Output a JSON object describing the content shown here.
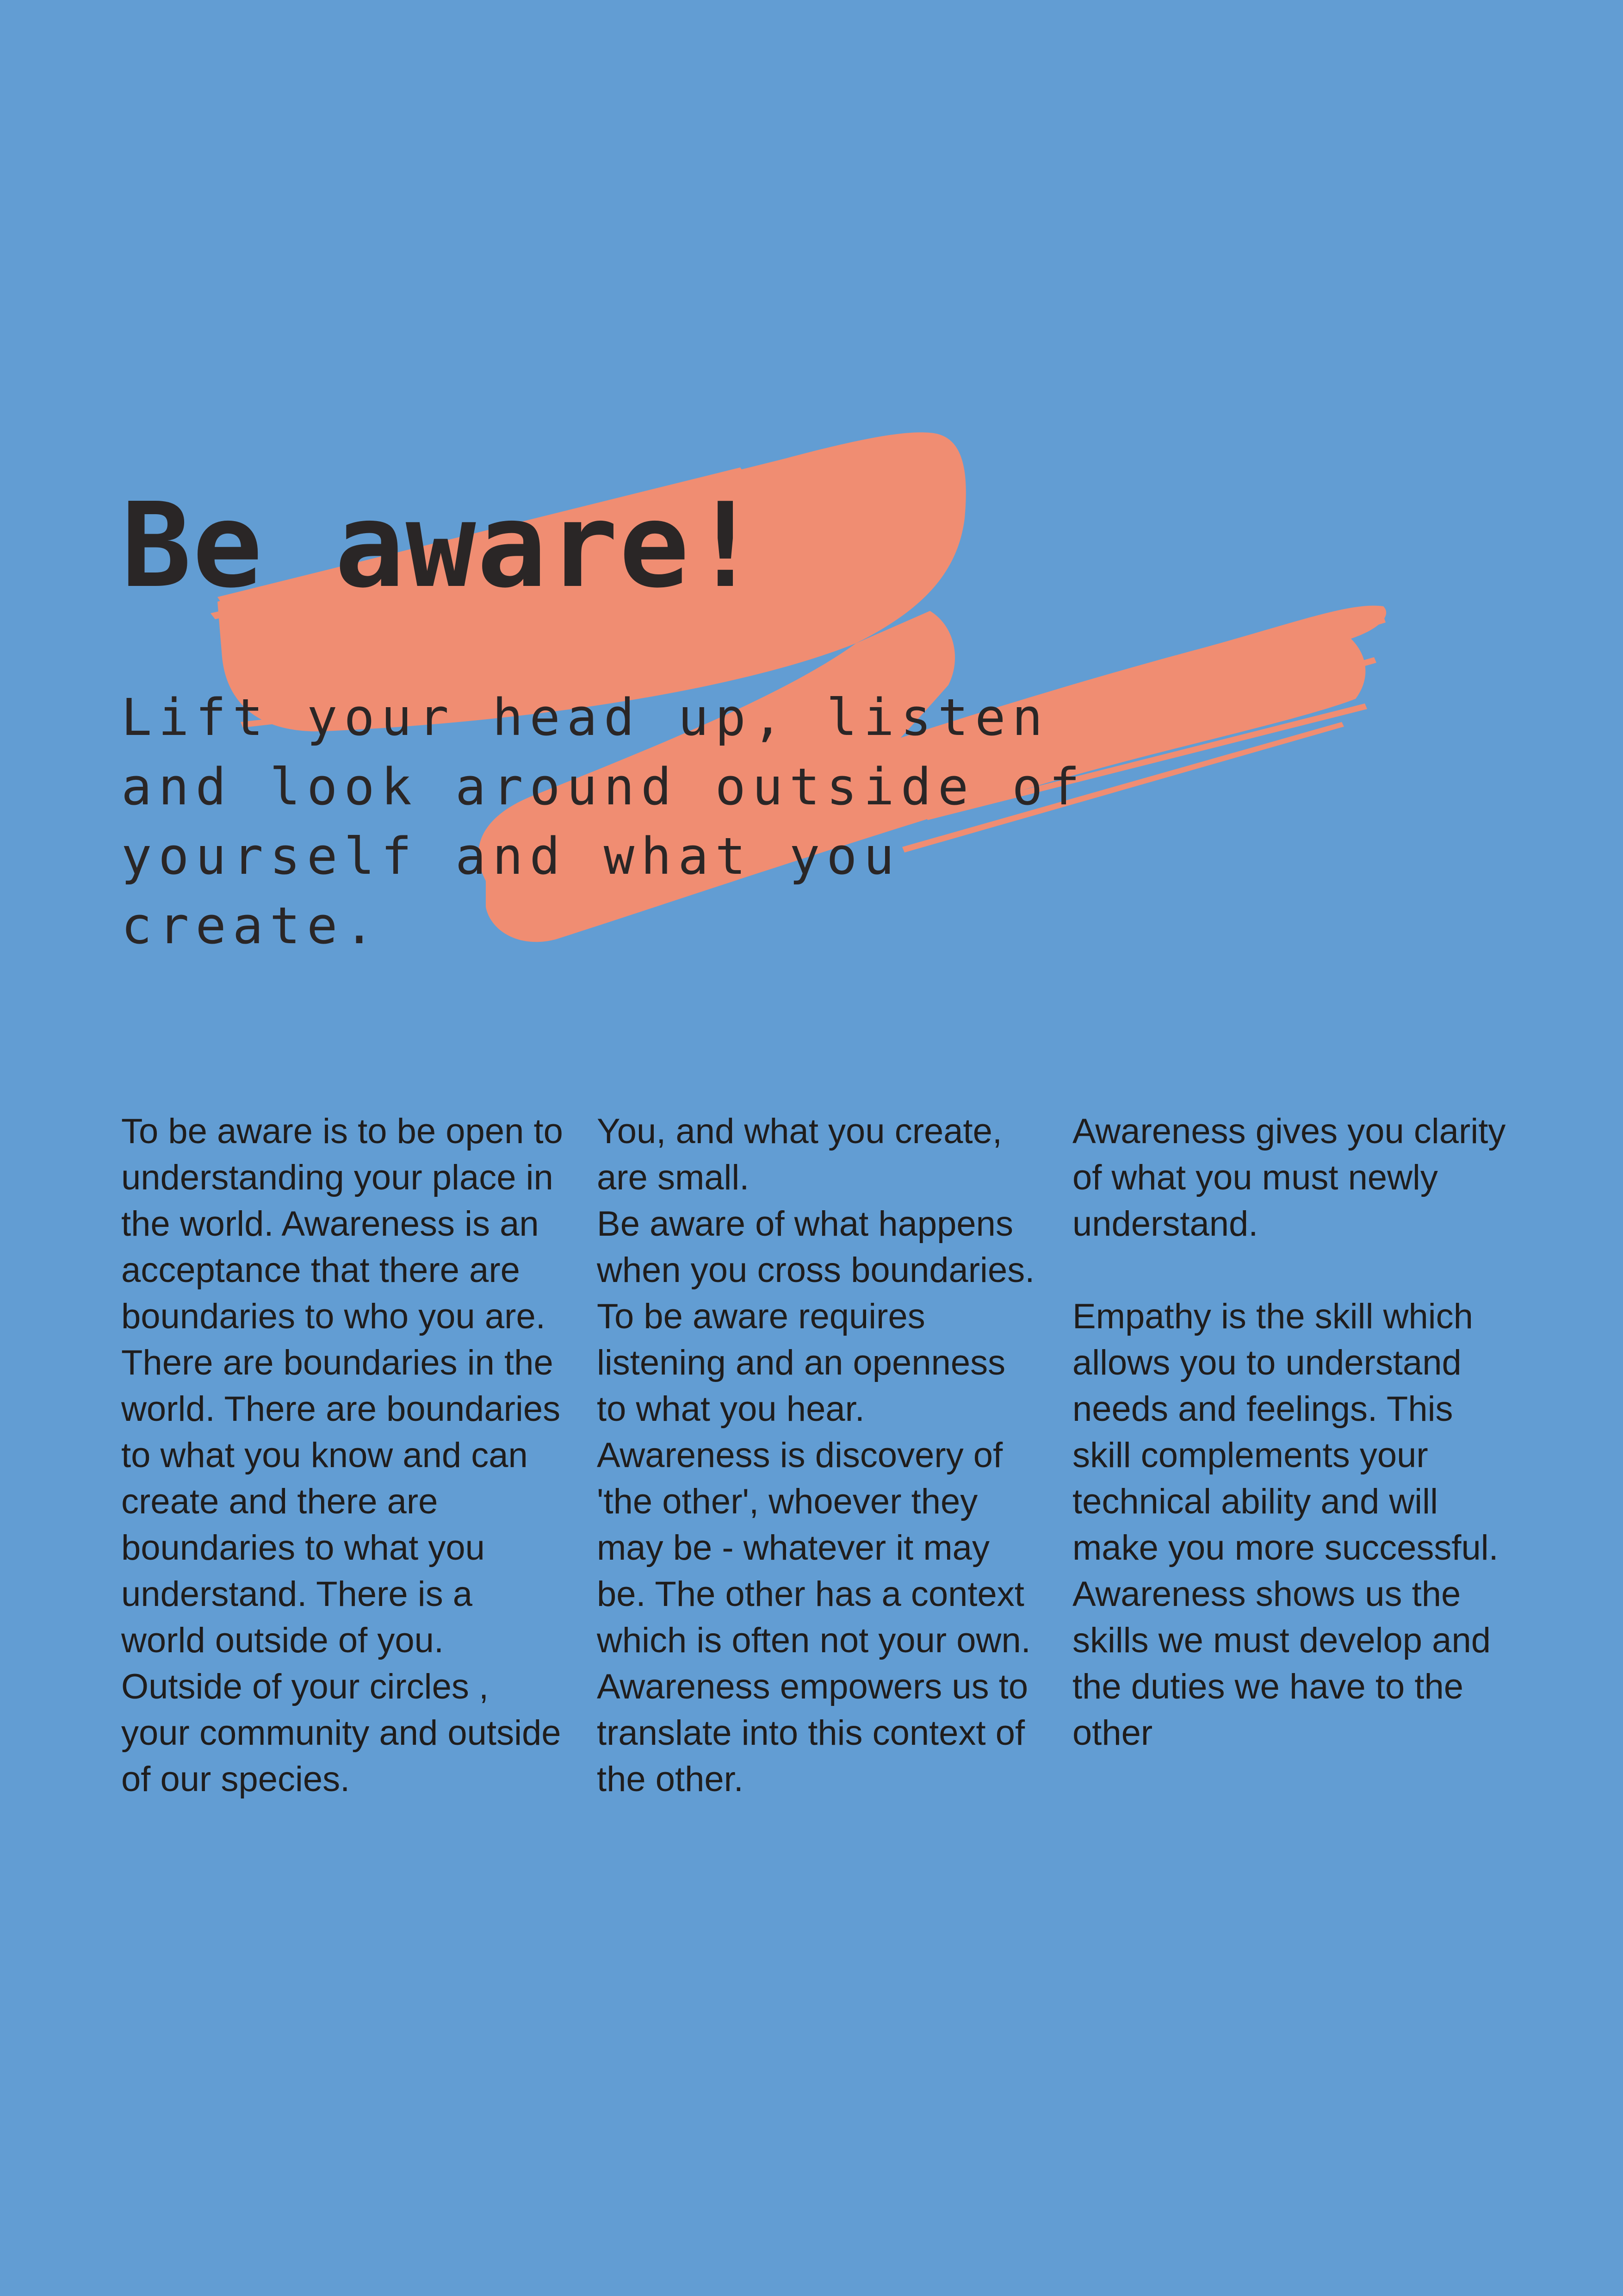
{
  "page": {
    "background_color": "#629dd3",
    "accent_color": "#f08d72",
    "text_color": "#2a2626"
  },
  "header": {
    "title": "Be aware!",
    "subtitle": "Lift your head up, listen and look around outside of yourself and what you create."
  },
  "body": {
    "columns": [
      {
        "text": "To be aware is to be open to understanding your place in the world. Awareness is an acceptance that there are boundaries to who you are. There are boundaries in the world. There are boundaries to what you know and can create and there are boundaries to what you understand. There is a world outside of you. Outside of your circles , your community and outside of our species."
      },
      {
        "text": "You, and what you create, are small.\nBe aware of what happens when you cross boundaries. To be aware requires listening and an openness to what you hear. Awareness is discovery of 'the other', whoever they may be - whatever it may be. The other has a context which is often not your own. Awareness empowers us to translate into this context of the other."
      },
      {
        "text": "Awareness gives you clarity of what you must newly understand.\n\nEmpathy is the skill which allows you to understand needs and feelings. This skill complements your technical ability and will make you more successful. Awareness shows us the skills we must develop and the duties we have to the other"
      }
    ]
  }
}
